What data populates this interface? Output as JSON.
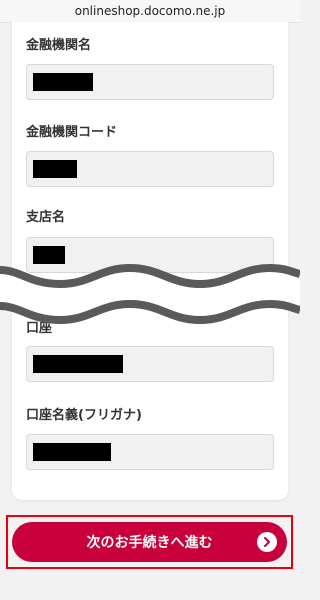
{
  "browser": {
    "url": "onlineshop.docomo.ne.jp"
  },
  "form": {
    "fields": [
      {
        "label": "金融機関名"
      },
      {
        "label": "金融機関コード"
      },
      {
        "label": "支店名"
      },
      {
        "label": "口座"
      },
      {
        "label": "口座名義(フリガナ)"
      }
    ]
  },
  "submit": {
    "label": "次のお手続きへ進む",
    "icon": "chevron-right-icon"
  },
  "colors": {
    "accent": "#c8003c",
    "highlight": "#e60012"
  }
}
